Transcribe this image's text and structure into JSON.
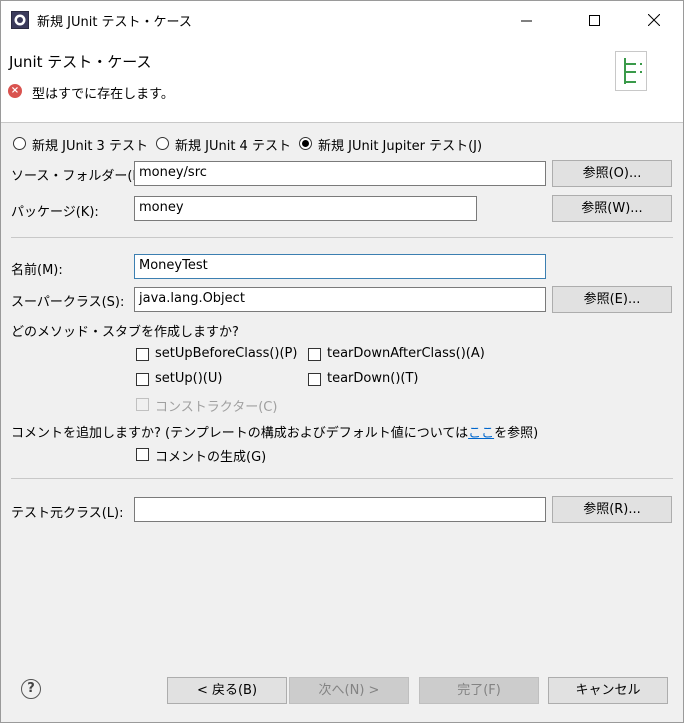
{
  "window": {
    "title": "新規 JUnit テスト・ケース"
  },
  "header": {
    "title": "Junit テスト・ケース",
    "message": "型はすでに存在します。"
  },
  "radios": [
    {
      "label": "新規 JUnit 3 テスト",
      "selected": false
    },
    {
      "label": "新規 JUnit 4 テスト",
      "selected": false
    },
    {
      "label": "新規 JUnit Jupiter テスト(J)",
      "selected": true
    }
  ],
  "source_folder": {
    "label": "ソース・フォルダー(D):",
    "value": "money/src",
    "browse": "参照(O)..."
  },
  "package": {
    "label": "パッケージ(K):",
    "value": "money",
    "browse": "参照(W)..."
  },
  "name": {
    "label": "名前(M):",
    "value": "MoneyTest"
  },
  "superclass": {
    "label": "スーパークラス(S):",
    "value": "java.lang.Object",
    "browse": "参照(E)..."
  },
  "stubs": {
    "question": "どのメソッド・スタブを作成しますか?",
    "items": [
      {
        "label": "setUpBeforeClass()(P)",
        "checked": false,
        "enabled": true
      },
      {
        "label": "tearDownAfterClass()(A)",
        "checked": false,
        "enabled": true
      },
      {
        "label": "setUp()(U)",
        "checked": false,
        "enabled": true
      },
      {
        "label": "tearDown()(T)",
        "checked": false,
        "enabled": true
      },
      {
        "label": "コンストラクター(C)",
        "checked": false,
        "enabled": false
      }
    ]
  },
  "comments": {
    "question_pre": "コメントを追加しますか? (テンプレートの構成およびデフォルト値については",
    "link": "ここ",
    "question_post": "を参照)",
    "generate": "コメントの生成(G)"
  },
  "class_under_test": {
    "label": "テスト元クラス(L):",
    "value": "",
    "browse": "参照(R)..."
  },
  "footer": {
    "back": "< 戻る(B)",
    "next": "次へ(N) >",
    "finish": "完了(F)",
    "cancel": "キャンセル"
  }
}
